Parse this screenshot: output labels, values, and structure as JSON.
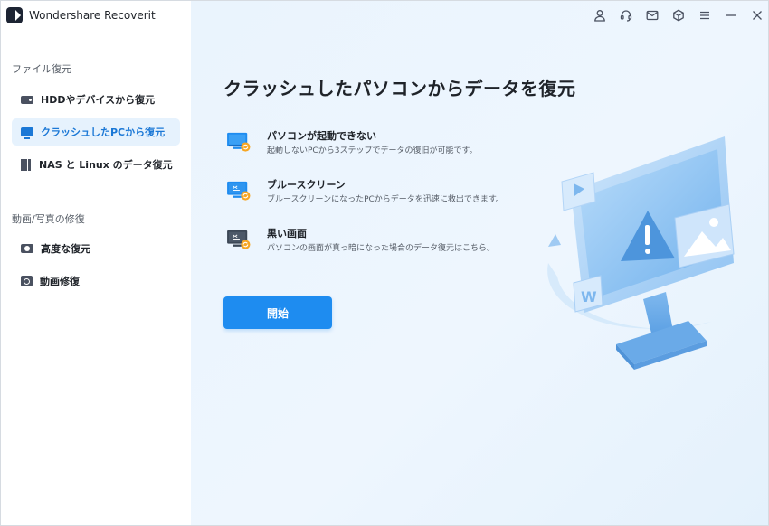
{
  "app": {
    "title": "Wondershare Recoverit"
  },
  "sidebar": {
    "section1": "ファイル復元",
    "items1": [
      {
        "label": "HDDやデバイスから復元",
        "icon": "hdd-icon",
        "active": false
      },
      {
        "label": "クラッシュしたPCから復元",
        "icon": "pc-icon",
        "active": true
      },
      {
        "label": "NAS と Linux のデータ復元",
        "icon": "nas-icon",
        "active": false
      }
    ],
    "section2": "動画/写真の修復",
    "items2": [
      {
        "label": "高度な復元",
        "icon": "camera-icon"
      },
      {
        "label": "動画修復",
        "icon": "video-repair-icon"
      }
    ]
  },
  "topbar": {
    "icons": [
      "account-icon",
      "support-headset-icon",
      "mail-icon",
      "box-icon",
      "menu-icon",
      "minimize-icon",
      "close-icon"
    ]
  },
  "main": {
    "title": "クラッシュしたパソコンからデータを復元",
    "options": [
      {
        "title": "パソコンが起動できない",
        "desc": "起動しないPCから3ステップでデータの復旧が可能です。",
        "icon": "pc-boot-failure-icon"
      },
      {
        "title": "ブルースクリーン",
        "desc": "ブルースクリーンになったPCからデータを迅速に救出できます。",
        "icon": "blue-screen-icon"
      },
      {
        "title": "黒い画面",
        "desc": "パソコンの画面が真っ暗になった場合のデータ復元はこちら。",
        "icon": "black-screen-icon"
      }
    ],
    "start_label": "開始"
  },
  "colors": {
    "accent": "#1e8cf0",
    "active_bg": "#e6f2fd",
    "active_text": "#1b78d6"
  }
}
